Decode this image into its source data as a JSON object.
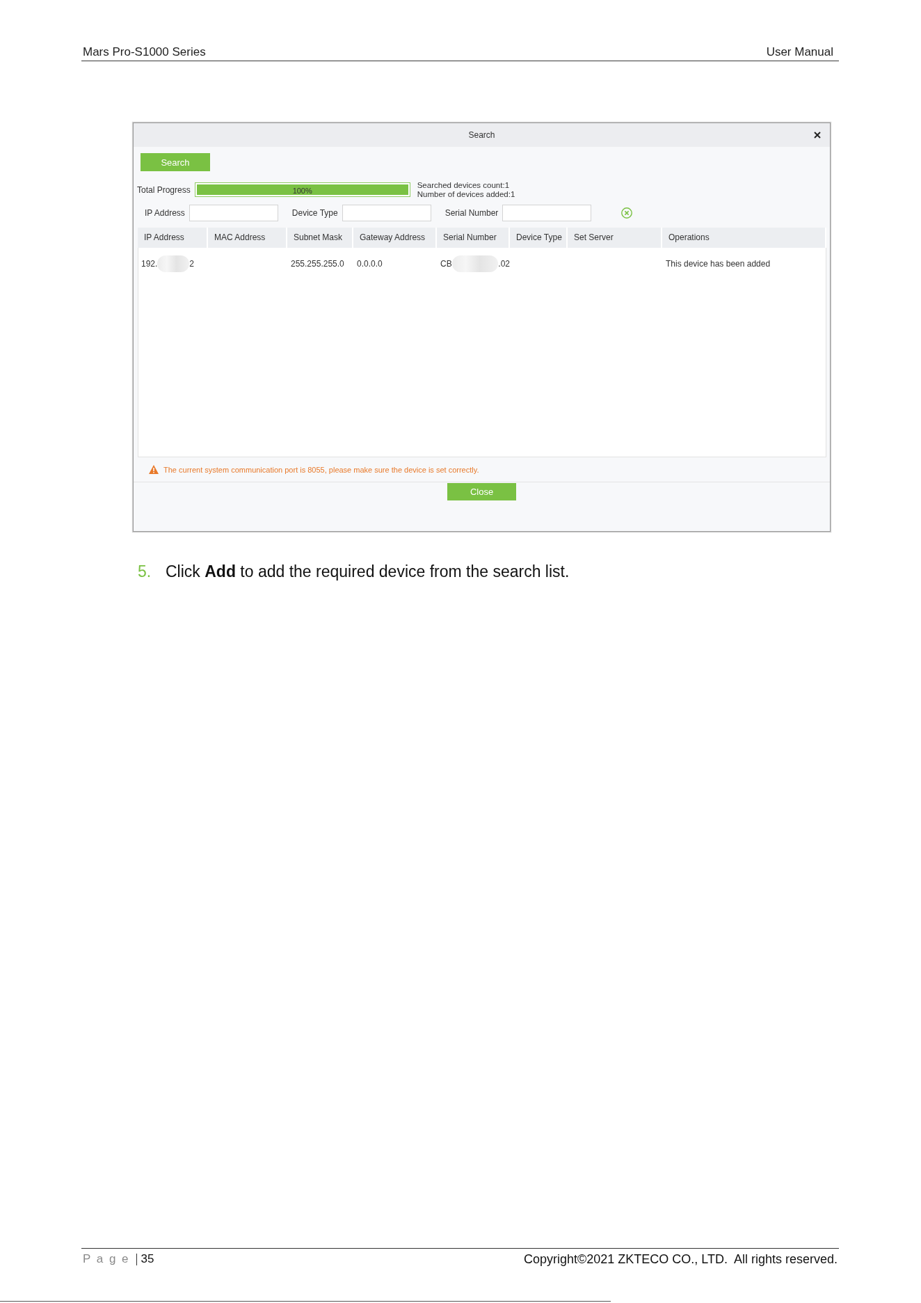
{
  "header": {
    "title": "Mars Pro-S1000 Series",
    "section": "User Manual"
  },
  "dialog": {
    "title": "Search",
    "search_button": "Search",
    "progress": {
      "label": "Total Progress",
      "level": 1,
      "reading": "100%"
    },
    "stats": [
      "Searched devices count:1",
      "Number of devices added:1"
    ],
    "filters": [
      {
        "label": "IP Address"
      },
      {
        "label": "Device Type"
      },
      {
        "label": "Serial Number"
      }
    ],
    "table": {
      "columns": [
        "IP Address",
        "MAC Address",
        "Subnet Mask",
        "Gateway Address",
        "Serial Number",
        "Device Type",
        "Set Server",
        "Operations"
      ],
      "rows": [
        {
          "ip_address": {
            "start": "192.",
            "end": "2",
            "redacted": true
          },
          "subnet_mask": "255.255.255.0",
          "gateway_address": "0.0.0.0",
          "serial_number": {
            "start": "CB",
            "end": ".02",
            "redacted": true
          },
          "operations": "This device has been added"
        }
      ]
    },
    "warning": "The current system communication port is 8055, please make sure the device is set correctly.",
    "close_button": "Close"
  },
  "step": {
    "number": "5.",
    "text": "Click **Add** to add the required device from the search list."
  },
  "footer": {
    "page_label": "P a g e",
    "page_number": "35",
    "copyright": "Copyright©2021 ZKTECO CO., LTD.  All rights reserved."
  }
}
